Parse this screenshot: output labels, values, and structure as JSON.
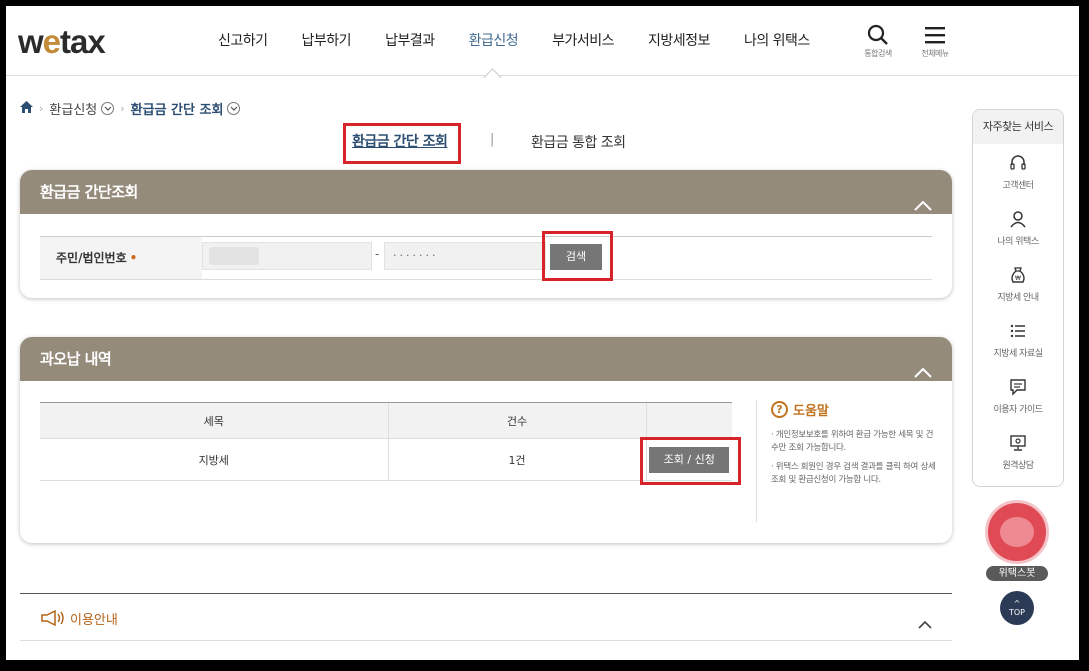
{
  "header": {
    "logo_left": "w",
    "logo_e": "e",
    "logo_right": "tax",
    "nav": [
      "신고하기",
      "납부하기",
      "납부결과",
      "환급신청",
      "부가서비스",
      "지방세정보",
      "나의 위택스"
    ],
    "active_nav": "환급신청",
    "search_caption": "통합검색",
    "menu_caption": "전체메뉴"
  },
  "breadcrumb": {
    "level1": "환급신청",
    "level2": "환급금 간단 조회"
  },
  "tabs": {
    "active": "환급금 간단 조회",
    "divider": "|",
    "other": "환급금 통합 조회"
  },
  "search_panel": {
    "title": "환급금 간단조회",
    "label": "주민/법인번호",
    "required_mark": "•",
    "dash": "-",
    "masked_value": "·······",
    "search_button": "검색"
  },
  "result_panel": {
    "title": "과오납 내역",
    "columns": [
      "세목",
      "건수",
      ""
    ],
    "rows": [
      {
        "tax": "지방세",
        "count": "1건",
        "action": "조회 / 신청"
      }
    ],
    "help_title": "도움말",
    "help_items": [
      "· 개인정보보호를 위하여 환급 가능한 세목 및 건수만 조회 가능합니다.",
      "· 위택스 회원인 경우 검색 결과를 클릭 하여 상세 조회 및 환급신청이 가능합 니다."
    ]
  },
  "usage": {
    "label": "이용안내"
  },
  "quick_service": {
    "title": "자주찾는 서비스",
    "items": [
      "고객센터",
      "나의 위택스",
      "지방세 안내",
      "지방세 자료실",
      "이용자 가이드",
      "원격상담"
    ]
  },
  "mascot_label": "위택스봇",
  "top_button": "TOP",
  "colors": {
    "panel_header": "#958b7b",
    "highlight": "#d7242a",
    "accent_blue": "#2c4e72",
    "help_orange": "#c2741e"
  }
}
